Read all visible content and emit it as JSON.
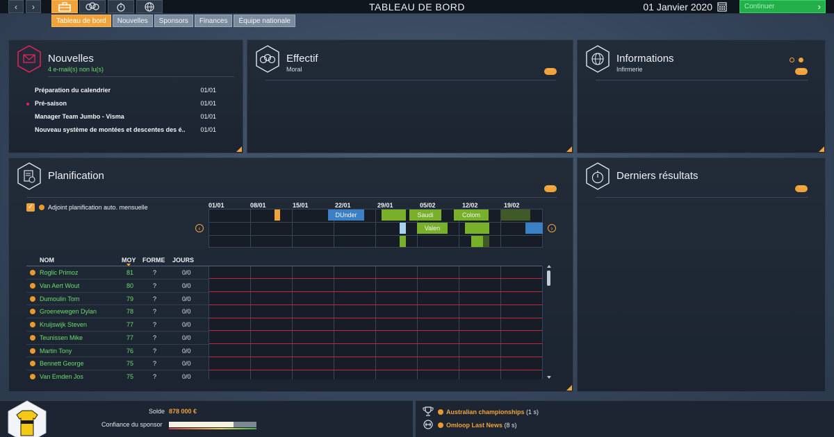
{
  "topbar": {
    "back_label": "‹",
    "forward_label": "›",
    "title": "TABLEAU DE BORD",
    "date": "01 Janvier 2020",
    "continue_label": "Continuer",
    "continue_arrow": "›"
  },
  "tabs": [
    {
      "label": "Tableau de bord",
      "active": true
    },
    {
      "label": "Nouvelles",
      "active": false
    },
    {
      "label": "Sponsors",
      "active": false
    },
    {
      "label": "Finances",
      "active": false
    },
    {
      "label": "Équipe nationale",
      "active": false
    }
  ],
  "news": {
    "title": "Nouvelles",
    "subtitle": "4 e-mail(s) non lu(s)",
    "items": [
      {
        "title": "Préparation du calendrier",
        "date": "01/01",
        "unread": false
      },
      {
        "title": "Pré-saison",
        "date": "01/01",
        "unread": true
      },
      {
        "title": "Manager Team Jumbo - Visma",
        "date": "01/01",
        "unread": false
      },
      {
        "title": "Nouveau système de montées et descentes des é..",
        "date": "01/01",
        "unread": false
      }
    ]
  },
  "effectif": {
    "title": "Effectif",
    "subtitle": "Moral"
  },
  "informations": {
    "title": "Informations",
    "subtitle": "Infirmerie"
  },
  "planning": {
    "title": "Planification",
    "auto_label": "Adjoint planification auto. mensuelle",
    "auto_checked": true,
    "weeks": [
      "01/01",
      "08/01",
      "15/01",
      "22/01",
      "29/01",
      "05/02",
      "12/02",
      "19/02"
    ],
    "races": [
      "DUnder",
      "Saudi",
      "Colom",
      "Valen"
    ],
    "columns": {
      "name": "NOM",
      "avg": "MOY",
      "form": "FORME",
      "days": "JOURS"
    },
    "riders": [
      {
        "name": "Roglic Primoz",
        "avg": "81",
        "form": "?",
        "days": "0/0"
      },
      {
        "name": "Van Aert Wout",
        "avg": "80",
        "form": "?",
        "days": "0/0"
      },
      {
        "name": "Dumoulin Tom",
        "avg": "79",
        "form": "?",
        "days": "0/0"
      },
      {
        "name": "Groenewegen Dylan",
        "avg": "78",
        "form": "?",
        "days": "0/0"
      },
      {
        "name": "Kruijswijk Steven",
        "avg": "77",
        "form": "?",
        "days": "0/0"
      },
      {
        "name": "Teunissen Mike",
        "avg": "77",
        "form": "?",
        "days": "0/0"
      },
      {
        "name": "Martin Tony",
        "avg": "76",
        "form": "?",
        "days": "0/0"
      },
      {
        "name": "Bennett George",
        "avg": "75",
        "form": "?",
        "days": "0/0"
      },
      {
        "name": "Van Emden Jos",
        "avg": "75",
        "form": "?",
        "days": "0/0"
      }
    ]
  },
  "results": {
    "title": "Derniers résultats"
  },
  "finances": {
    "balance_label": "Solde",
    "balance_value": "878 000 €",
    "sponsor_label": "Confiance du sponsor",
    "sponsor_confidence": 0.74
  },
  "events": [
    {
      "name": "Australian championships",
      "duration": "(1 s)"
    },
    {
      "name": "Omloop Last News",
      "duration": "(8 s)"
    }
  ],
  "colors": {
    "accent": "#f1a33a",
    "continue": "#23b04a",
    "rider_green": "#6ddc6f",
    "unread": "#e3245b"
  }
}
